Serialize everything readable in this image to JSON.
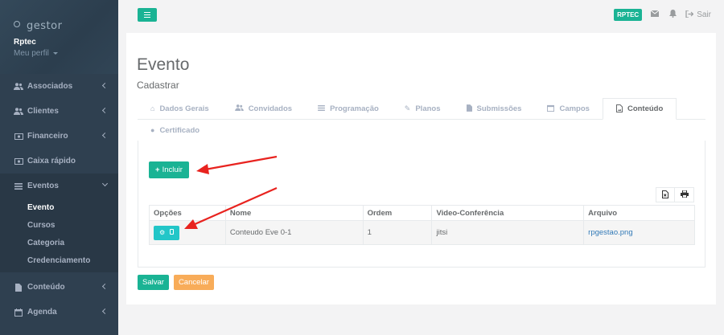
{
  "sidebar": {
    "logo_text": "gestor",
    "user_name": "Rptec",
    "user_menu": "Meu perfil",
    "items": [
      {
        "label": "Associados",
        "icon": "users-icon"
      },
      {
        "label": "Clientes",
        "icon": "users-icon"
      },
      {
        "label": "Financeiro",
        "icon": "money-icon"
      },
      {
        "label": "Caixa rápido",
        "icon": "money-icon"
      },
      {
        "label": "Eventos",
        "icon": "list-icon"
      },
      {
        "label": "Conteúdo",
        "icon": "file-icon"
      },
      {
        "label": "Agenda",
        "icon": "calendar-icon"
      }
    ],
    "sub_items": [
      "Evento",
      "Cursos",
      "Categoria",
      "Credenciamento"
    ]
  },
  "topbar": {
    "badge": "RPTEC",
    "logout_label": "Sair"
  },
  "page": {
    "title": "Evento",
    "subtitle": "Cadastrar"
  },
  "tabs": [
    "Dados Gerais",
    "Convidados",
    "Programação",
    "Planos",
    "Submissões",
    "Campos",
    "Conteúdo",
    "Certificado"
  ],
  "active_tab": "Conteúdo",
  "panel": {
    "include_label": "Incluir"
  },
  "table": {
    "headers": [
      "Opções",
      "Nome",
      "Ordem",
      "Video-Conferência",
      "Arquivo"
    ],
    "rows": [
      {
        "nome": "Conteudo Eve 0-1",
        "ordem": "1",
        "video": "jitsi",
        "arquivo": "rpgestao.png"
      }
    ]
  },
  "footer": {
    "save_label": "Salvar",
    "cancel_label": "Cancelar"
  },
  "colors": {
    "sidebar": "#2f4050",
    "primary": "#1ab394",
    "info": "#23c6c8",
    "warning": "#f8ac59",
    "annotation_arrow": "#e8231f"
  }
}
